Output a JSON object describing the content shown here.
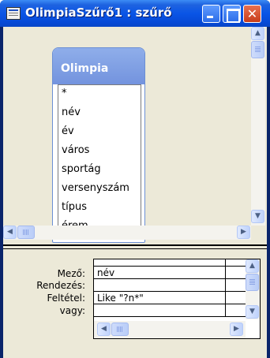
{
  "window": {
    "title": "OlimpiaSzűrő1 : szűrő",
    "buttons": {
      "minimize": "minimize",
      "maximize": "maximize",
      "close": "close"
    }
  },
  "table": {
    "name": "Olimpia",
    "fields": [
      "*",
      "név",
      "év",
      "város",
      "sportág",
      "versenyszám",
      "típus",
      "érem"
    ]
  },
  "grid": {
    "row_labels": [
      "Mező:",
      "Rendezés:",
      "Feltétel:",
      "vagy:"
    ],
    "column1": {
      "field": "név",
      "sort": "",
      "criteria": "Like \"?n*\"",
      "or": ""
    }
  },
  "icons": {
    "title": "query-window-icon",
    "scroll_up": "arrow-up-icon",
    "scroll_down": "arrow-down-icon",
    "scroll_left": "arrow-left-icon",
    "scroll_right": "arrow-right-icon"
  },
  "colors": {
    "titlebar": "#0a55e6",
    "table_header": "#7f9fe0",
    "client": "#ece9d8",
    "close_button": "#c73d1b"
  }
}
